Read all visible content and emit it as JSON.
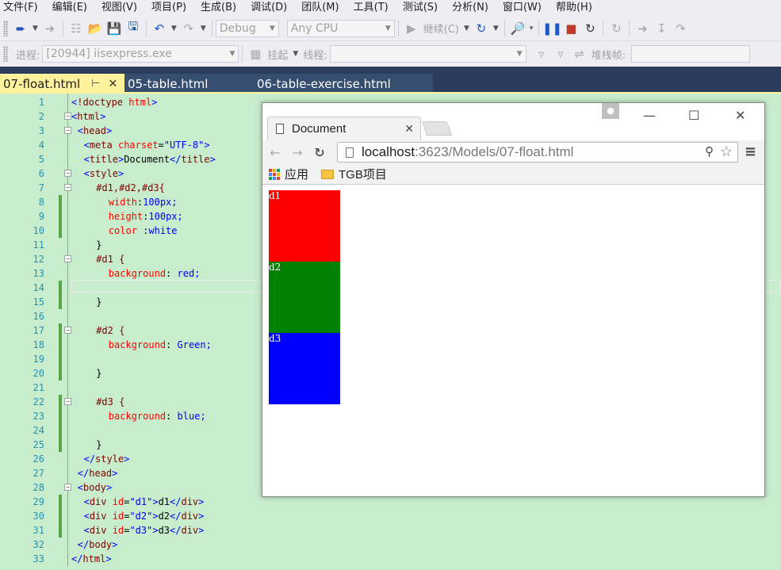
{
  "menu": [
    "文件(F)",
    "编辑(E)",
    "视图(V)",
    "项目(P)",
    "生成(B)",
    "调试(D)",
    "团队(M)",
    "工具(T)",
    "测试(S)",
    "分析(N)",
    "窗口(W)",
    "帮助(H)"
  ],
  "toolbar1": {
    "config": "Debug",
    "platform": "Any CPU",
    "continue_label": "继续(C)"
  },
  "toolbar2": {
    "process_label": "进程:",
    "process_value": "[20944] iisexpress.exe",
    "suspend_label": "挂起",
    "thread_label": "线程:",
    "stack_label": "堆栈帧:"
  },
  "tabs": [
    {
      "label": "07-float.html",
      "active": true
    },
    {
      "label": "05-table.html",
      "active": false
    },
    {
      "label": "06-table-exercise.html",
      "active": false
    }
  ],
  "editor": {
    "lines": [
      {
        "n": "1",
        "changed": false,
        "fold": ""
      },
      {
        "n": "2",
        "changed": false,
        "fold": "-"
      },
      {
        "n": "3",
        "changed": false,
        "fold": "-"
      },
      {
        "n": "4",
        "changed": false,
        "fold": ""
      },
      {
        "n": "5",
        "changed": false,
        "fold": ""
      },
      {
        "n": "6",
        "changed": false,
        "fold": "-"
      },
      {
        "n": "7",
        "changed": false,
        "fold": "-"
      },
      {
        "n": "8",
        "changed": true,
        "fold": ""
      },
      {
        "n": "9",
        "changed": true,
        "fold": ""
      },
      {
        "n": "10",
        "changed": true,
        "fold": ""
      },
      {
        "n": "11",
        "changed": false,
        "fold": ""
      },
      {
        "n": "12",
        "changed": false,
        "fold": "-"
      },
      {
        "n": "13",
        "changed": false,
        "fold": ""
      },
      {
        "n": "14",
        "changed": true,
        "fold": ""
      },
      {
        "n": "15",
        "changed": true,
        "fold": ""
      },
      {
        "n": "16",
        "changed": false,
        "fold": ""
      },
      {
        "n": "17",
        "changed": true,
        "fold": "-"
      },
      {
        "n": "18",
        "changed": true,
        "fold": ""
      },
      {
        "n": "19",
        "changed": true,
        "fold": ""
      },
      {
        "n": "20",
        "changed": true,
        "fold": ""
      },
      {
        "n": "21",
        "changed": false,
        "fold": ""
      },
      {
        "n": "22",
        "changed": true,
        "fold": "-"
      },
      {
        "n": "23",
        "changed": true,
        "fold": ""
      },
      {
        "n": "24",
        "changed": true,
        "fold": ""
      },
      {
        "n": "25",
        "changed": true,
        "fold": ""
      },
      {
        "n": "26",
        "changed": false,
        "fold": ""
      },
      {
        "n": "27",
        "changed": false,
        "fold": ""
      },
      {
        "n": "28",
        "changed": false,
        "fold": "-"
      },
      {
        "n": "29",
        "changed": true,
        "fold": ""
      },
      {
        "n": "30",
        "changed": true,
        "fold": ""
      },
      {
        "n": "31",
        "changed": true,
        "fold": ""
      },
      {
        "n": "32",
        "changed": false,
        "fold": ""
      },
      {
        "n": "33",
        "changed": false,
        "fold": ""
      }
    ],
    "code": [
      "<!doctype html>",
      "<html>",
      "<head>",
      "<meta charset=\"UTF-8\">",
      "<title>Document</title>",
      "<style>",
      "#d1,#d2,#d3{",
      "width:100px;",
      "height:100px;",
      "color :white",
      "}",
      "#d1 {",
      "background: red;",
      "",
      "}",
      "",
      "#d2 {",
      "background: Green;",
      "",
      "}",
      "",
      "#d3 {",
      "background: blue;",
      "",
      "}",
      "</style>",
      "</head>",
      "<body>",
      "<div id=\"d1\">d1</div>",
      "<div id=\"d2\">d2</div>",
      "<div id=\"d3\">d3</div>",
      "</body>",
      "</html>"
    ]
  },
  "browser": {
    "tab_title": "Document",
    "url_host": "localhost",
    "url_rest": ":3623/Models/07-float.html",
    "bookmarks": [
      "应用",
      "TGB项目"
    ],
    "boxes": [
      {
        "label": "d1",
        "color": "#ff0000"
      },
      {
        "label": "d2",
        "color": "#008000"
      },
      {
        "label": "d3",
        "color": "#0000ff"
      }
    ]
  }
}
